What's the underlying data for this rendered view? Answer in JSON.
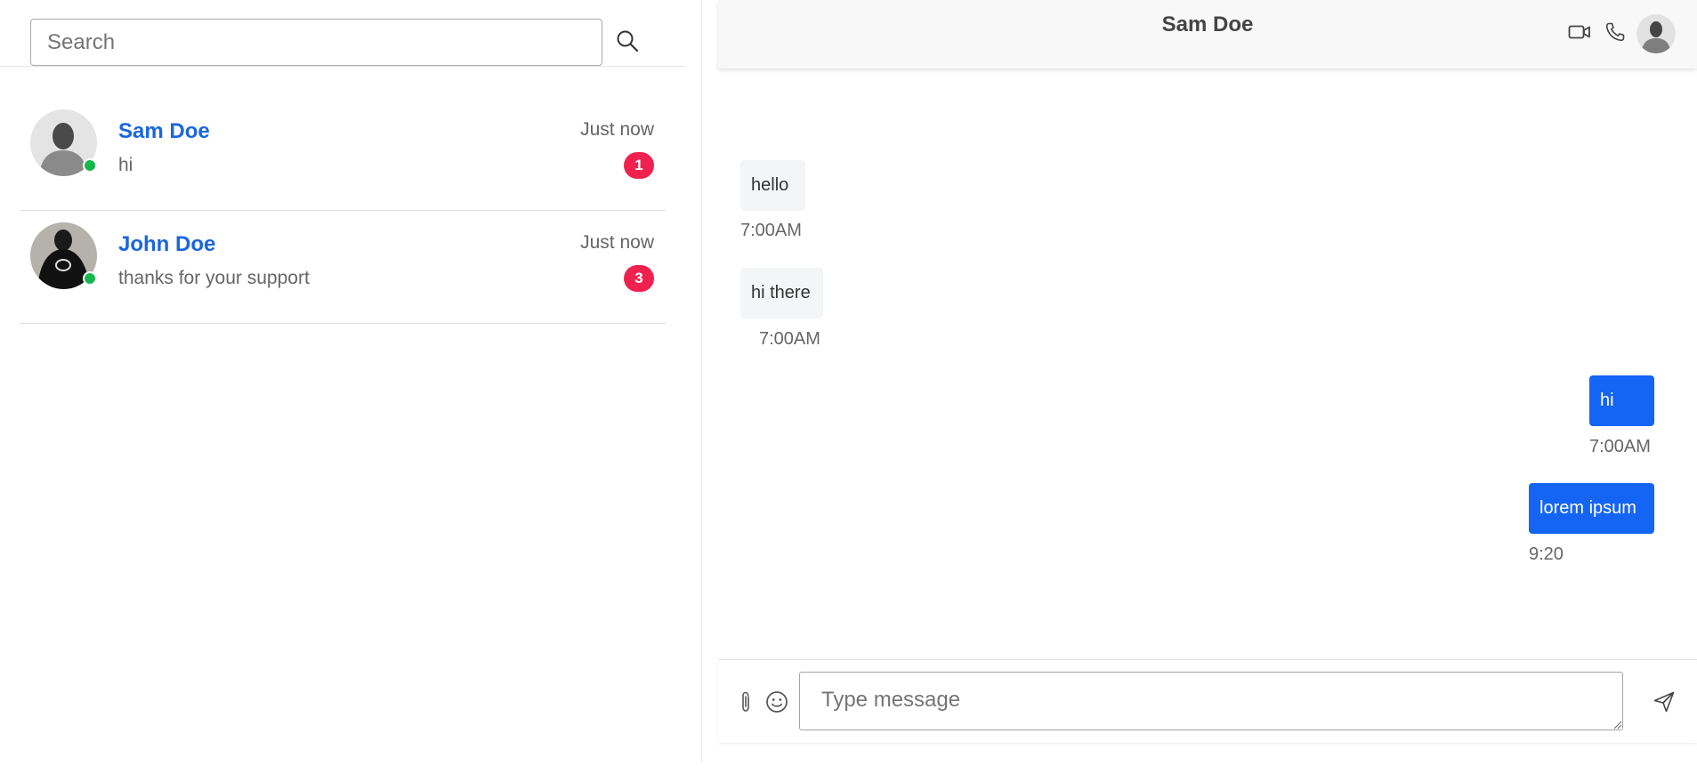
{
  "search": {
    "placeholder": "Search",
    "icon": "search-icon"
  },
  "chats": [
    {
      "name": "Sam Doe",
      "preview": "hi",
      "time": "Just now",
      "unread": "1",
      "online": true
    },
    {
      "name": "John Doe",
      "preview": "thanks for your support",
      "time": "Just now",
      "unread": "3",
      "online": true
    }
  ],
  "conversation": {
    "title": "Sam Doe",
    "header_icons": [
      "video-camera-icon",
      "phone-icon"
    ],
    "messages": [
      {
        "text": "hello",
        "time": "7:00AM",
        "direction": "incoming"
      },
      {
        "text": "hi there",
        "time": "7:00AM",
        "direction": "incoming"
      },
      {
        "text": "hi",
        "time": "7:00AM",
        "direction": "outgoing"
      },
      {
        "text": "lorem ipsum",
        "time": "9:20",
        "direction": "outgoing"
      }
    ]
  },
  "composer": {
    "placeholder": "Type message",
    "icons": [
      "paperclip-icon",
      "emoji-icon",
      "send-icon"
    ]
  },
  "colors": {
    "accent": "#1a66e0",
    "outgoing_bubble": "#1565f5",
    "incoming_bubble": "#f4f5f6",
    "badge": "#f0214f",
    "online": "#16b84d"
  }
}
